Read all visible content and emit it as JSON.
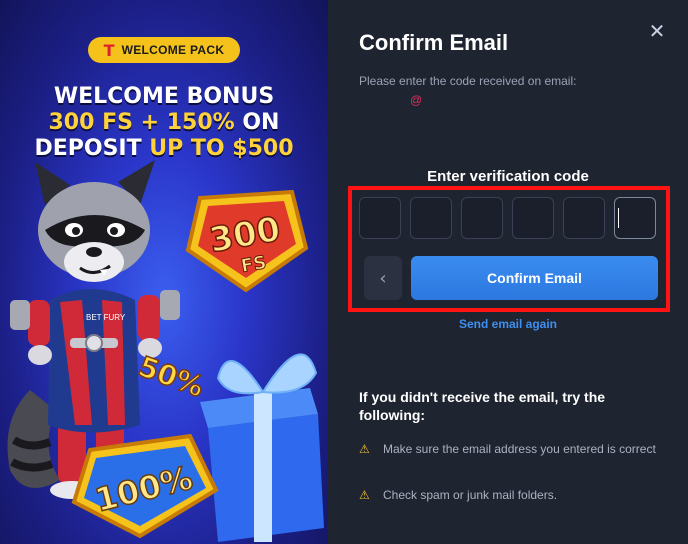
{
  "promo": {
    "badge_logo": "T",
    "badge_text": "WELCOME PACK",
    "headline_line1": "WELCOME BONUS",
    "headline_line2_yellow": "300 FS + 150%",
    "headline_line2_white": "ON",
    "headline_line3_white": "DEPOSIT",
    "headline_line3_yellow": "UP TO $500",
    "badge_300_num": "300",
    "badge_300_unit": "FS",
    "badge_50": "50%",
    "badge_100": "100%",
    "mascot_chest_text": "BET FURY"
  },
  "dialog": {
    "title": "Confirm Email",
    "subtitle": "Please enter the code received on email:",
    "email_masked": "@",
    "verification_label": "Enter verification code",
    "code_digits": [
      "",
      "",
      "",
      "",
      "",
      ""
    ],
    "back_icon": "chevron-left-icon",
    "confirm_label": "Confirm Email",
    "send_again_label": "Send email again",
    "help_title": "If you didn't receive the email, try the following:",
    "tips": [
      "Make sure the email address you entered is correct",
      "Check spam or junk mail folders."
    ],
    "close_icon": "close-icon"
  },
  "colors": {
    "accent_blue": "#2c78e0",
    "highlight_red": "#ff1313",
    "warning_yellow": "#f3c232",
    "panel_bg": "#1f2431"
  }
}
